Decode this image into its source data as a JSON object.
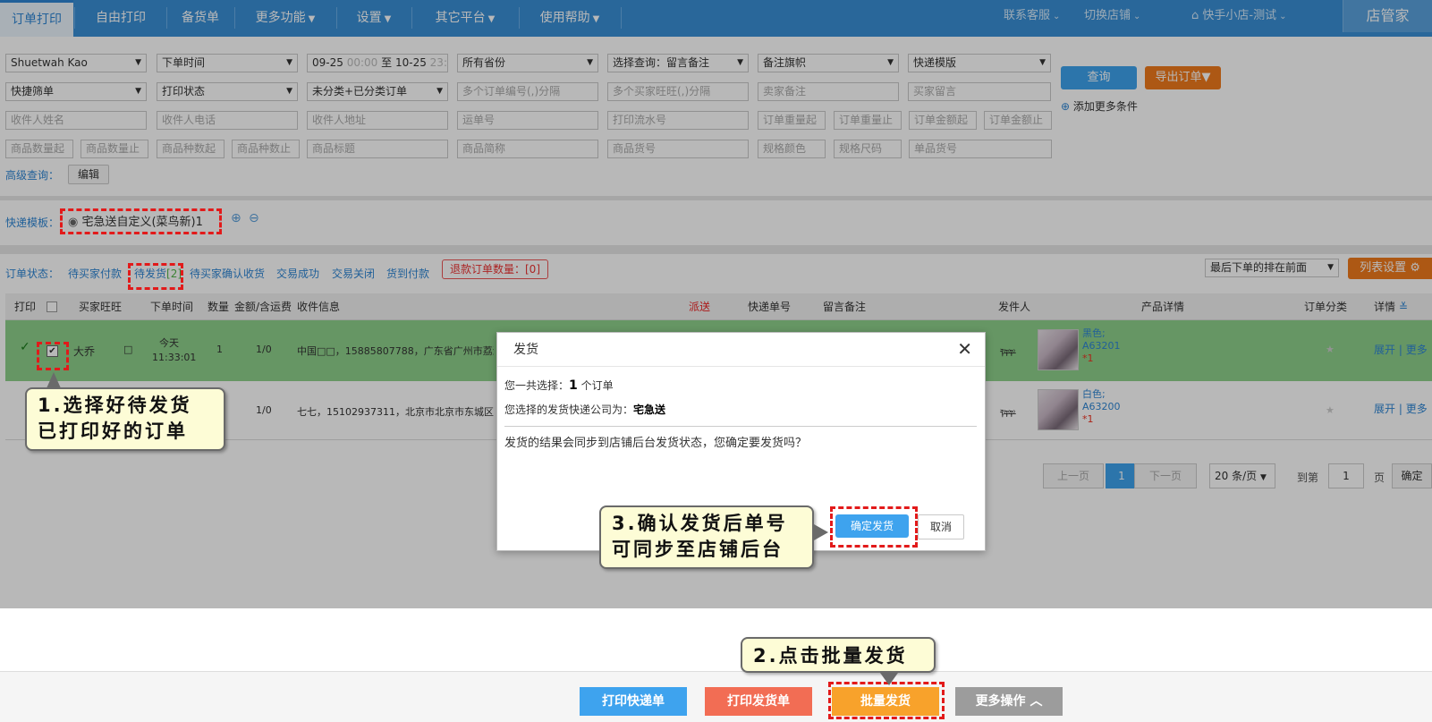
{
  "nav": {
    "tabs": [
      {
        "label": "订单打印"
      },
      {
        "label": "自由打印"
      },
      {
        "label": "备货单"
      },
      {
        "label": "更多功能"
      },
      {
        "label": "设置"
      },
      {
        "label": "其它平台"
      },
      {
        "label": "使用帮助"
      }
    ],
    "contact": "联系客服",
    "switch_shop": "切换店铺",
    "shop_name": "快手小店-测试",
    "brand": "店管家"
  },
  "filters": {
    "row1": [
      "Shuetwah Kao",
      "下单时间",
      "",
      "所有省份",
      "选择查询：留言备注",
      "备注旗帜",
      "快递模版"
    ],
    "date_from": "09-25",
    "time_from": "00:00",
    "date_sep": "至",
    "date_to": "10-25",
    "time_to": "23:59",
    "row2": [
      "快捷筛单",
      "打印状态",
      "未分类+已分类订单",
      "多个订单编号(,)分隔",
      "多个买家旺旺(,)分隔",
      "卖家备注",
      "买家留言"
    ],
    "row3": [
      "收件人姓名",
      "收件人电话",
      "收件人地址",
      "运单号",
      "打印流水号",
      "订单重量起",
      "订单重量止",
      "订单金额起",
      "订单金额止"
    ],
    "row4": [
      "商品数量起",
      "商品数量止",
      "商品种数起",
      "商品种数止",
      "商品标题",
      "商品简称",
      "商品货号",
      "规格颜色",
      "规格尺码",
      "单品货号"
    ],
    "search_btn": "查询",
    "export_btn": "导出订单▼",
    "add_more": "添加更多条件",
    "advanced_label": "高级查询：",
    "edit_btn": "编辑"
  },
  "template": {
    "label": "快递模板：",
    "name": "宅急送自定义(菜鸟新)1"
  },
  "status": {
    "label": "订单状态：",
    "items": [
      "待买家付款",
      "待发货",
      "待买家确认收货",
      "交易成功",
      "交易关闭",
      "货到付款"
    ],
    "pending_count": "[2]",
    "refund": "退款订单数量：[0]",
    "sort": "最后下单的排在前面",
    "list_settings": "列表设置"
  },
  "table": {
    "headers": [
      "打印",
      "买家旺旺",
      "下单时间",
      "数量",
      "金额/含运费",
      "收件信息",
      "派送",
      "快递单号",
      "留言备注",
      "发件人",
      "产品详情",
      "订单分类",
      "详情"
    ],
    "rows": [
      {
        "buyer": "大乔",
        "mark": "□",
        "time1": "今天",
        "time2": "11:33:01",
        "qty": "1",
        "amount": "1/0",
        "address": "中国□□，15885807788，广东省广州市荔湾",
        "sender": "ᢪᢪᢪ",
        "sku_color": "黑色;",
        "sku_code": "A63201",
        "sku_qty": "*1",
        "expand": "展开",
        "more": "更多"
      },
      {
        "buyer": "",
        "mark": "",
        "time1": "",
        "time2": "",
        "qty": "",
        "amount": "1/0",
        "address": "七七，15102937311，北京市北京市东城区",
        "sender": "ᢪᢪᢪ",
        "sku_color": "白色;",
        "sku_code": "A63200",
        "sku_qty": "*1",
        "expand": "展开",
        "more": "更多"
      }
    ]
  },
  "pager": {
    "prev": "上一页",
    "page": "1",
    "next": "下一页",
    "per_page": "20 条/页",
    "goto": "到第",
    "goto_value": "1",
    "page_unit": "页",
    "confirm": "确定"
  },
  "modal": {
    "title": "发货",
    "selected_prefix": "您一共选择：",
    "selected_count": "1",
    "selected_suffix": "个订单",
    "company_prefix": "您选择的发货快递公司为：",
    "company": "宅急送",
    "message": "发货的结果会同步到店铺后台发货状态，您确定要发货吗？",
    "confirm": "确定发货",
    "cancel": "取消"
  },
  "bottom": {
    "print_express": "打印快递单",
    "print_invoice": "打印发货单",
    "batch_ship": "批量发货",
    "more_ops": "更多操作"
  },
  "callouts": {
    "step1_line1": "1.选择好待发货",
    "step1_line2": "已打印好的订单",
    "step2": "2.点击批量发货",
    "step3_line1": "3.确认发货后单号",
    "step3_line2": "可同步至店铺后台"
  },
  "colors": {
    "nav_blue": "#3a8fd6",
    "selected_row": "#8ed08b",
    "annotation_red": "#e21a1a",
    "callout_bg": "#fdfcd6"
  }
}
